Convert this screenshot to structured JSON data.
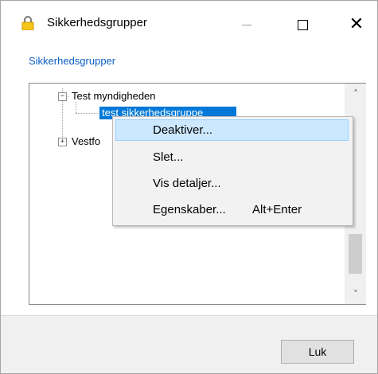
{
  "window": {
    "title": "Sikkerhedsgrupper",
    "icon": "lock-icon",
    "controls": {
      "minimize": "minimize-icon",
      "maximize": "maximize-icon",
      "close": "✕"
    }
  },
  "header": {
    "label": "Sikkerhedsgrupper"
  },
  "tree": {
    "nodes": [
      {
        "label": "Test myndigheden",
        "expander": "−",
        "expanded": true
      },
      {
        "label": "test sikkerhedsgruppe",
        "selected": true
      },
      {
        "label": "Vestfo",
        "expander": "+",
        "expanded": false
      }
    ],
    "scrollbar": {
      "up": "˄",
      "down": "˅"
    }
  },
  "context_menu": {
    "items": [
      {
        "label": "Deaktiver...",
        "shortcut": ""
      },
      {
        "label": "Slet...",
        "shortcut": ""
      },
      {
        "label": "Vis detaljer...",
        "shortcut": ""
      },
      {
        "label": "Egenskaber...",
        "shortcut": "Alt+Enter"
      }
    ]
  },
  "footer": {
    "close_label": "Luk"
  },
  "colors": {
    "accent": "#0078d7",
    "link": "#0b5fc6",
    "menu_hover": "#cce8ff"
  }
}
